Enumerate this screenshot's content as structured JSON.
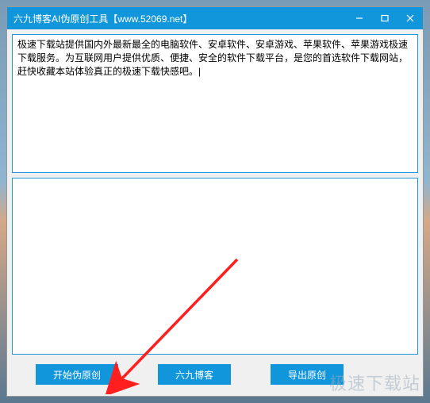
{
  "titlebar": {
    "title": "六九博客AI伪原创工具【www.52069.net】"
  },
  "textareas": {
    "input_text": "极速下载站提供国内外最新最全的电脑软件、安卓软件、安卓游戏、苹果软件、苹果游戏极速下载服务。为互联网用户提供优质、便捷、安全的软件下载平台，是您的首选软件下载网站，赶快收藏本站体验真正的极速下载快感吧。|",
    "output_text": ""
  },
  "buttons": {
    "start": "开始伪原创",
    "blog": "六九博客",
    "export": "导出原创"
  },
  "watermark": "极速下载站"
}
